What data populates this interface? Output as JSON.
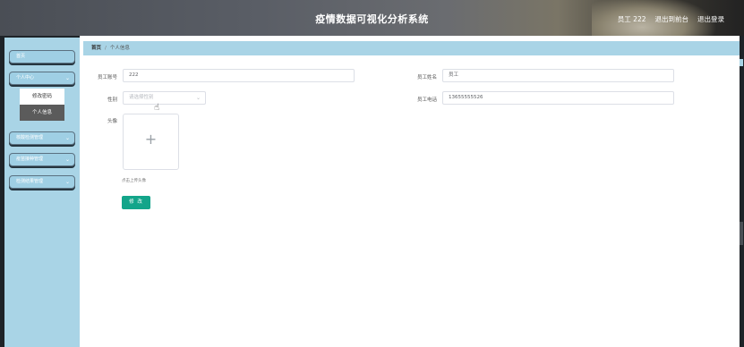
{
  "header": {
    "title": "疫情数据可视化分析系统",
    "user": "员工 222",
    "back_to_front": "退出到前台",
    "logout": "退出登录"
  },
  "sidebar": {
    "items": [
      {
        "label": "首页"
      },
      {
        "label": "个人中心"
      },
      {
        "label": "核酸检测管理"
      },
      {
        "label": "疫苗接种管理"
      },
      {
        "label": "检测结果管理"
      }
    ],
    "submenu": [
      {
        "label": "修改密码"
      },
      {
        "label": "个人信息"
      }
    ]
  },
  "breadcrumb": {
    "home": "首页",
    "current": "个人信息"
  },
  "form": {
    "emp_no_label": "员工账号",
    "emp_no_value": "222",
    "emp_name_label": "员工姓名",
    "emp_name_value": "员工",
    "gender_label": "性别",
    "gender_placeholder": "请选择性别",
    "phone_label": "员工电话",
    "phone_value": "13655555526",
    "avatar_label": "头像",
    "upload_tip": "点击上传头像",
    "submit_label": "修 改"
  }
}
